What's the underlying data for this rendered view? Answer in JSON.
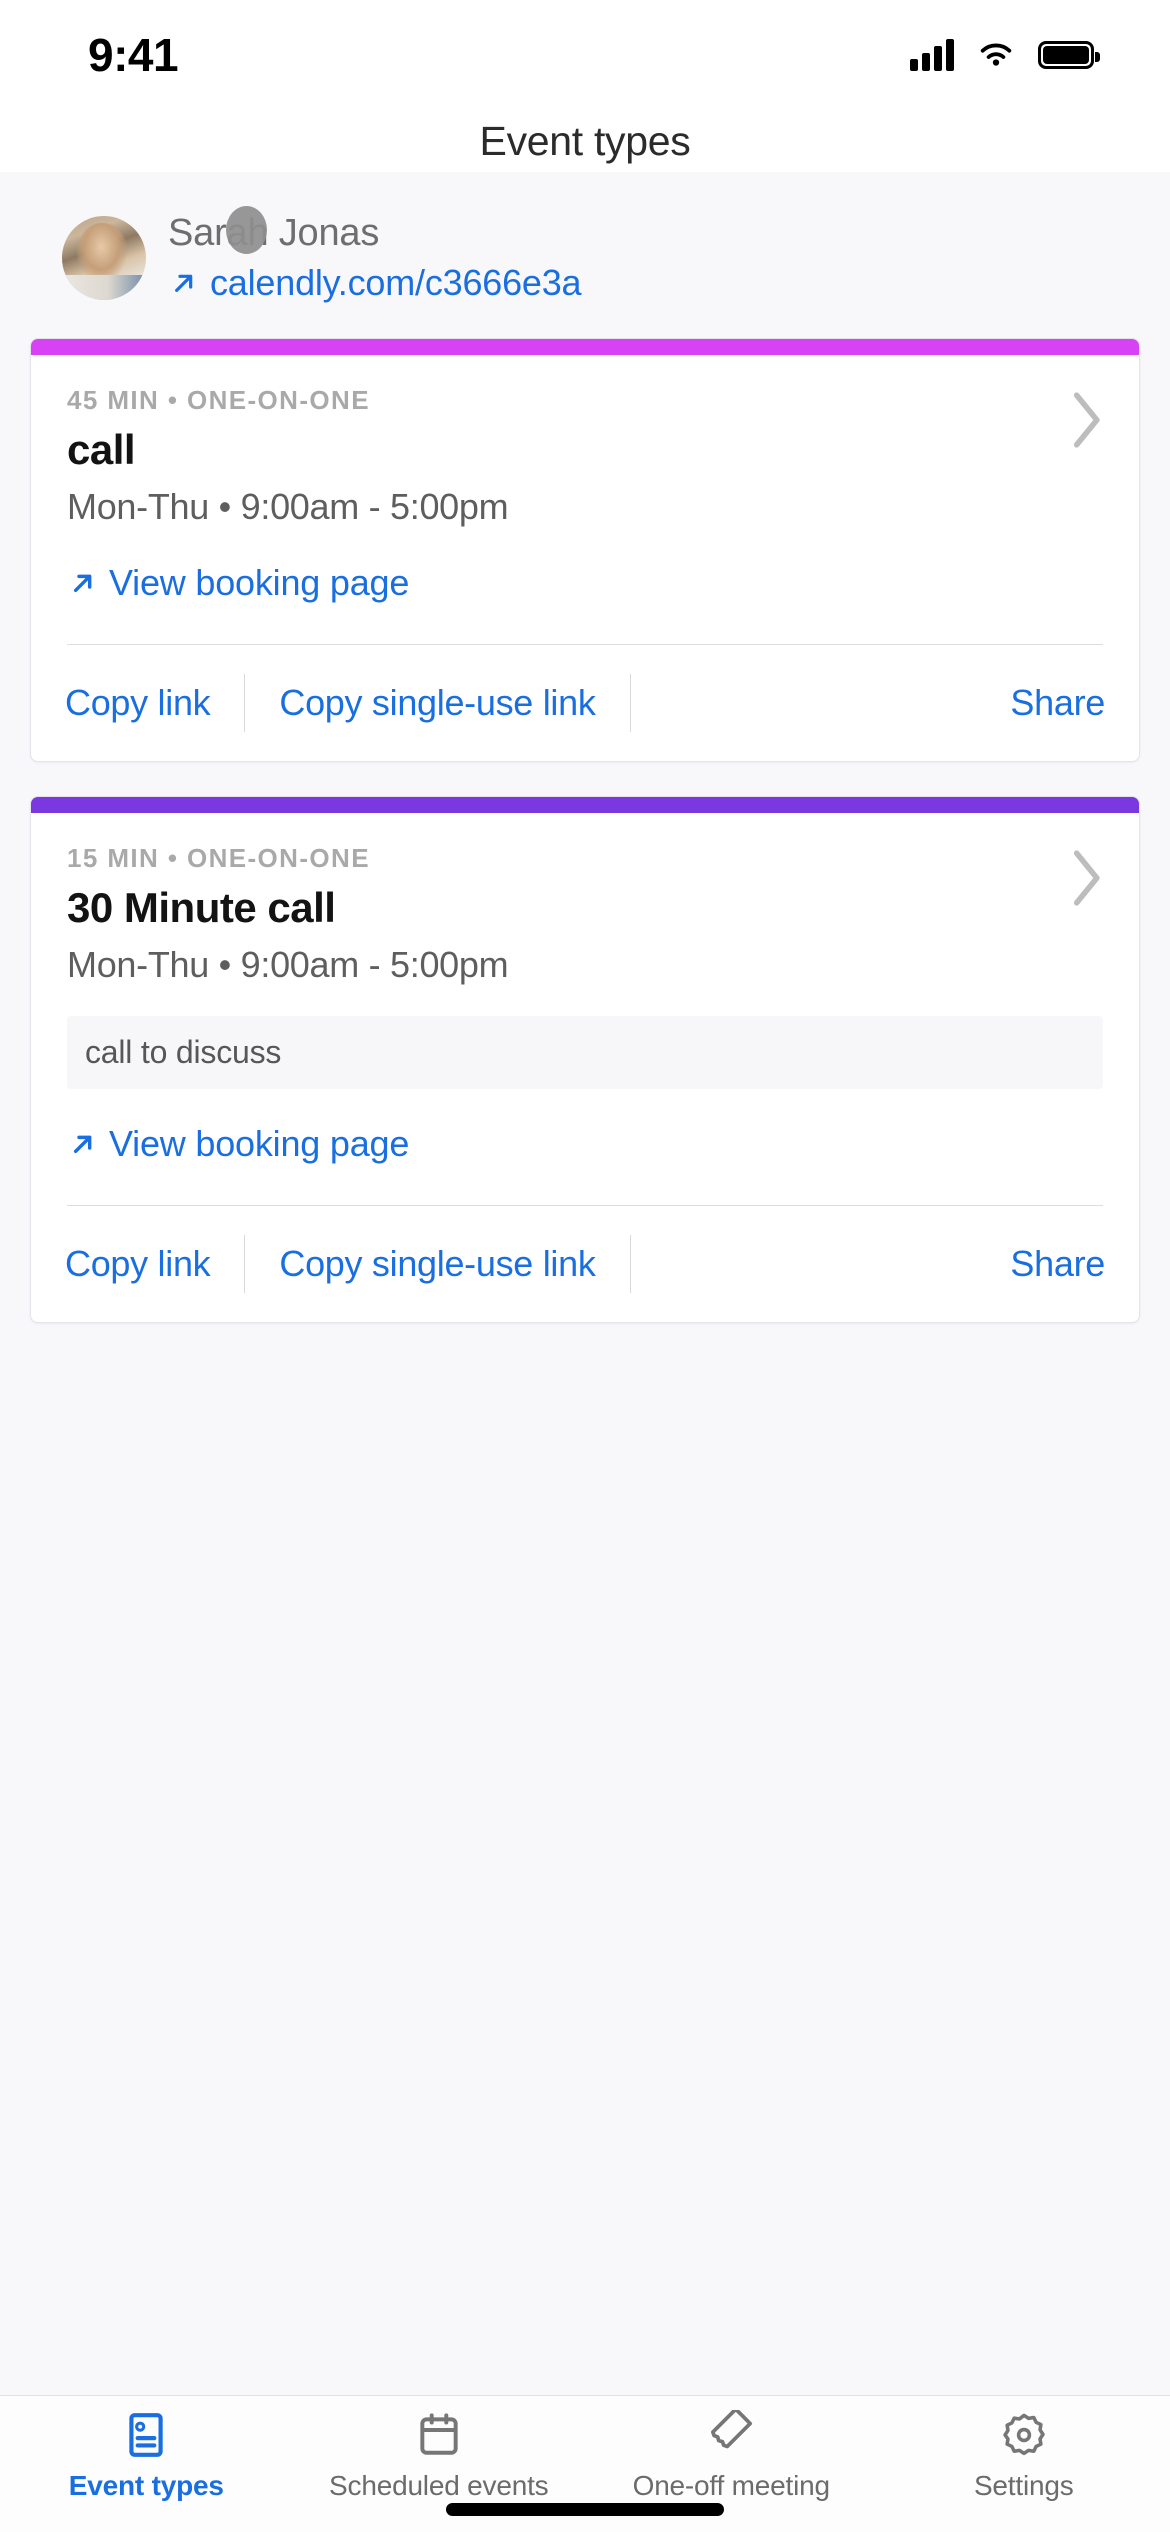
{
  "status_bar": {
    "time": "9:41",
    "signal_icon": "cellular-signal-icon",
    "wifi_icon": "wifi-icon",
    "battery_icon": "battery-icon"
  },
  "header": {
    "title": "Event types"
  },
  "profile": {
    "avatar_alt": "Sarah Jonas profile photo",
    "name": "Sarah Jonas",
    "link": "calendly.com/c3666e3a",
    "link_icon": "external-link-arrow-icon"
  },
  "colors": {
    "accent_blue": "#1a6fe0",
    "page_background": "#F8F7FA",
    "card_bar_1": "#D742F5",
    "card_bar_2": "#7B37E0",
    "muted_text": "#a9a9a9"
  },
  "event_cards": [
    {
      "bar_color": "#D742F5",
      "meta": "45 MIN • ONE-ON-ONE",
      "title": "call",
      "schedule": "Mon-Thu • 9:00am - 5:00pm",
      "description": "",
      "booking_label": "View booking page",
      "actions": {
        "copy_link": "Copy link",
        "copy_single_use_link": "Copy single-use link",
        "share": "Share"
      },
      "chevron_icon": "chevron-right-icon"
    },
    {
      "bar_color": "#7B37E0",
      "meta": "15 MIN • ONE-ON-ONE",
      "title": "30 Minute call",
      "schedule": "Mon-Thu • 9:00am - 5:00pm",
      "description": "call to discuss",
      "booking_label": "View booking page",
      "actions": {
        "copy_link": "Copy link",
        "copy_single_use_link": "Copy single-use link",
        "share": "Share"
      },
      "chevron_icon": "chevron-right-icon"
    }
  ],
  "tab_bar": {
    "items": [
      {
        "label": "Event types",
        "icon": "event-types-card-icon",
        "active": true
      },
      {
        "label": "Scheduled events",
        "icon": "calendar-icon",
        "active": false
      },
      {
        "label": "One-off meeting",
        "icon": "ticket-tag-icon",
        "active": false
      },
      {
        "label": "Settings",
        "icon": "gear-icon",
        "active": false
      }
    ]
  }
}
